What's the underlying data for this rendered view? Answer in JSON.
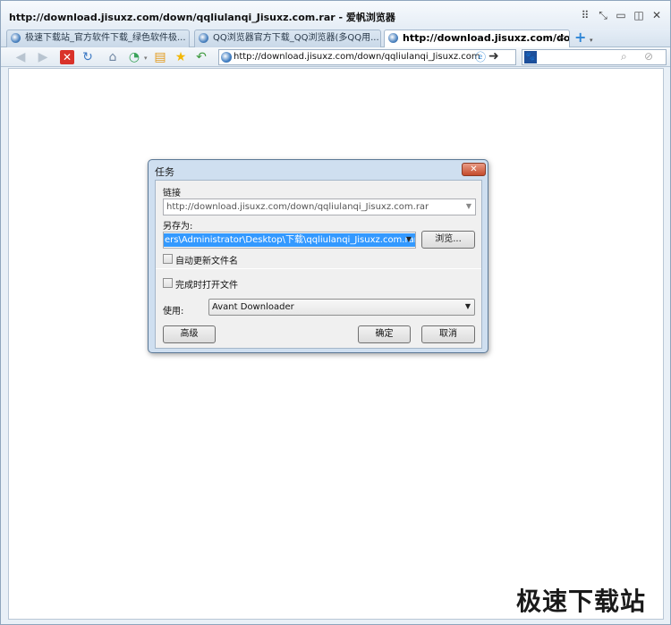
{
  "window": {
    "title": "http://download.jisuxz.com/down/qqliulanqi_Jisuxz.com.rar - 爱帆浏览器",
    "controls": [
      "grid-icon",
      "pin-icon",
      "minimize-icon",
      "restore-icon",
      "close-icon"
    ]
  },
  "tabs": [
    {
      "label": "极速下载站_官方软件下载_绿色软件极...",
      "active": false
    },
    {
      "label": "QQ浏览器官方下载_QQ浏览器(多QQ用...",
      "active": false
    },
    {
      "label": "http://download.jisuxz.com/down...",
      "active": true,
      "close": "×"
    }
  ],
  "newtab": {
    "label": "+"
  },
  "toolbar": {
    "icons": [
      "back-icon",
      "forward-icon",
      "stop-icon",
      "refresh-icon",
      "home-icon",
      "history-icon",
      "favorites-add-icon",
      "favorites-icon",
      "undo-icon"
    ],
    "address": "http://download.jisuxz.com/down/qqliulanqi_Jisuxz.com"
  },
  "dialog": {
    "title": "任务",
    "close": "✕",
    "link_label": "链接",
    "link_value": "http://download.jisuxz.com/down/qqliulanqi_Jisuxz.com.rar",
    "save_as_label": "另存为:",
    "save_as_value": "ers\\Administrator\\Desktop\\下载\\qqliulanqi_Jisuxz.com.rar",
    "browse_button": "浏览...",
    "auto_update_label": "自动更新文件名",
    "auto_update_checked": false,
    "open_when_done_label": "完成时打开文件",
    "open_when_done_checked": false,
    "use_label": "使用:",
    "use_value": "Avant Downloader",
    "advanced_button": "高级",
    "ok_button": "确定",
    "cancel_button": "取消"
  },
  "watermark": "极速下载站"
}
